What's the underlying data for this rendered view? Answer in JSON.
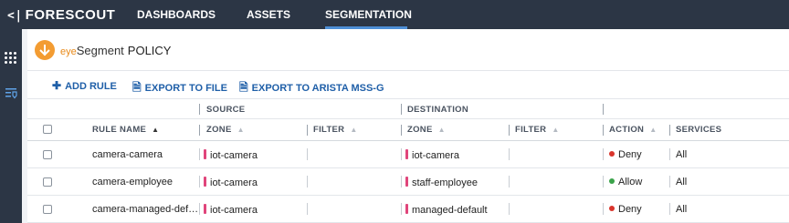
{
  "app": {
    "logo": "FORESCOUT",
    "logo_mark": "<|"
  },
  "nav": [
    {
      "label": "DASHBOARDS",
      "active": false
    },
    {
      "label": "ASSETS",
      "active": false
    },
    {
      "label": "SEGMENTATION",
      "active": true
    }
  ],
  "page": {
    "brand_prefix": "eye",
    "brand_name": "Segment",
    "title": "POLICY"
  },
  "toolbar": {
    "add_rule": "ADD RULE",
    "export_file": "EXPORT TO FILE",
    "export_arista": "EXPORT TO ARISTA MSS-G"
  },
  "table": {
    "groups": {
      "source": "SOURCE",
      "destination": "DESTINATION"
    },
    "columns": {
      "rule_name": "RULE NAME",
      "zone": "ZONE",
      "filter": "FILTER",
      "dest_zone": "ZONE",
      "dest_filter": "FILTER",
      "action": "ACTION",
      "services": "SERVICES"
    },
    "rows": [
      {
        "name": "camera-camera",
        "src_zone": "iot-camera",
        "dst_zone": "iot-camera",
        "action": "Deny",
        "services": "All"
      },
      {
        "name": "camera-employee",
        "src_zone": "iot-camera",
        "dst_zone": "staff-employee",
        "action": "Allow",
        "services": "All"
      },
      {
        "name": "camera-managed-def…",
        "src_zone": "iot-camera",
        "dst_zone": "managed-default",
        "action": "Deny",
        "services": "All"
      }
    ]
  },
  "colors": {
    "topbar": "#2c3645",
    "accent_blue": "#1f5fa8",
    "zone_pink": "#e0457b",
    "deny_red": "#d9342b",
    "allow_green": "#3aa34a",
    "brand_orange": "#f39c32"
  }
}
